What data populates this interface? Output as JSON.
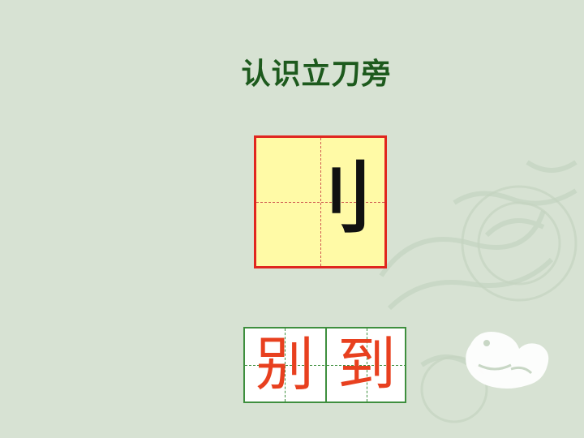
{
  "title": "认识立刀旁",
  "radical": "刂",
  "words": [
    "别",
    "到"
  ],
  "colors": {
    "background": "#d7e2d3",
    "title": "#1d5a1d",
    "radical_box_fill": "#fffaa6",
    "radical_box_border": "#e0261f",
    "word_grid_border": "#3e8f3e",
    "word_text": "#e8401f"
  },
  "decoration": {
    "dragon_emblem_icon": "dragon-emblem-icon"
  }
}
